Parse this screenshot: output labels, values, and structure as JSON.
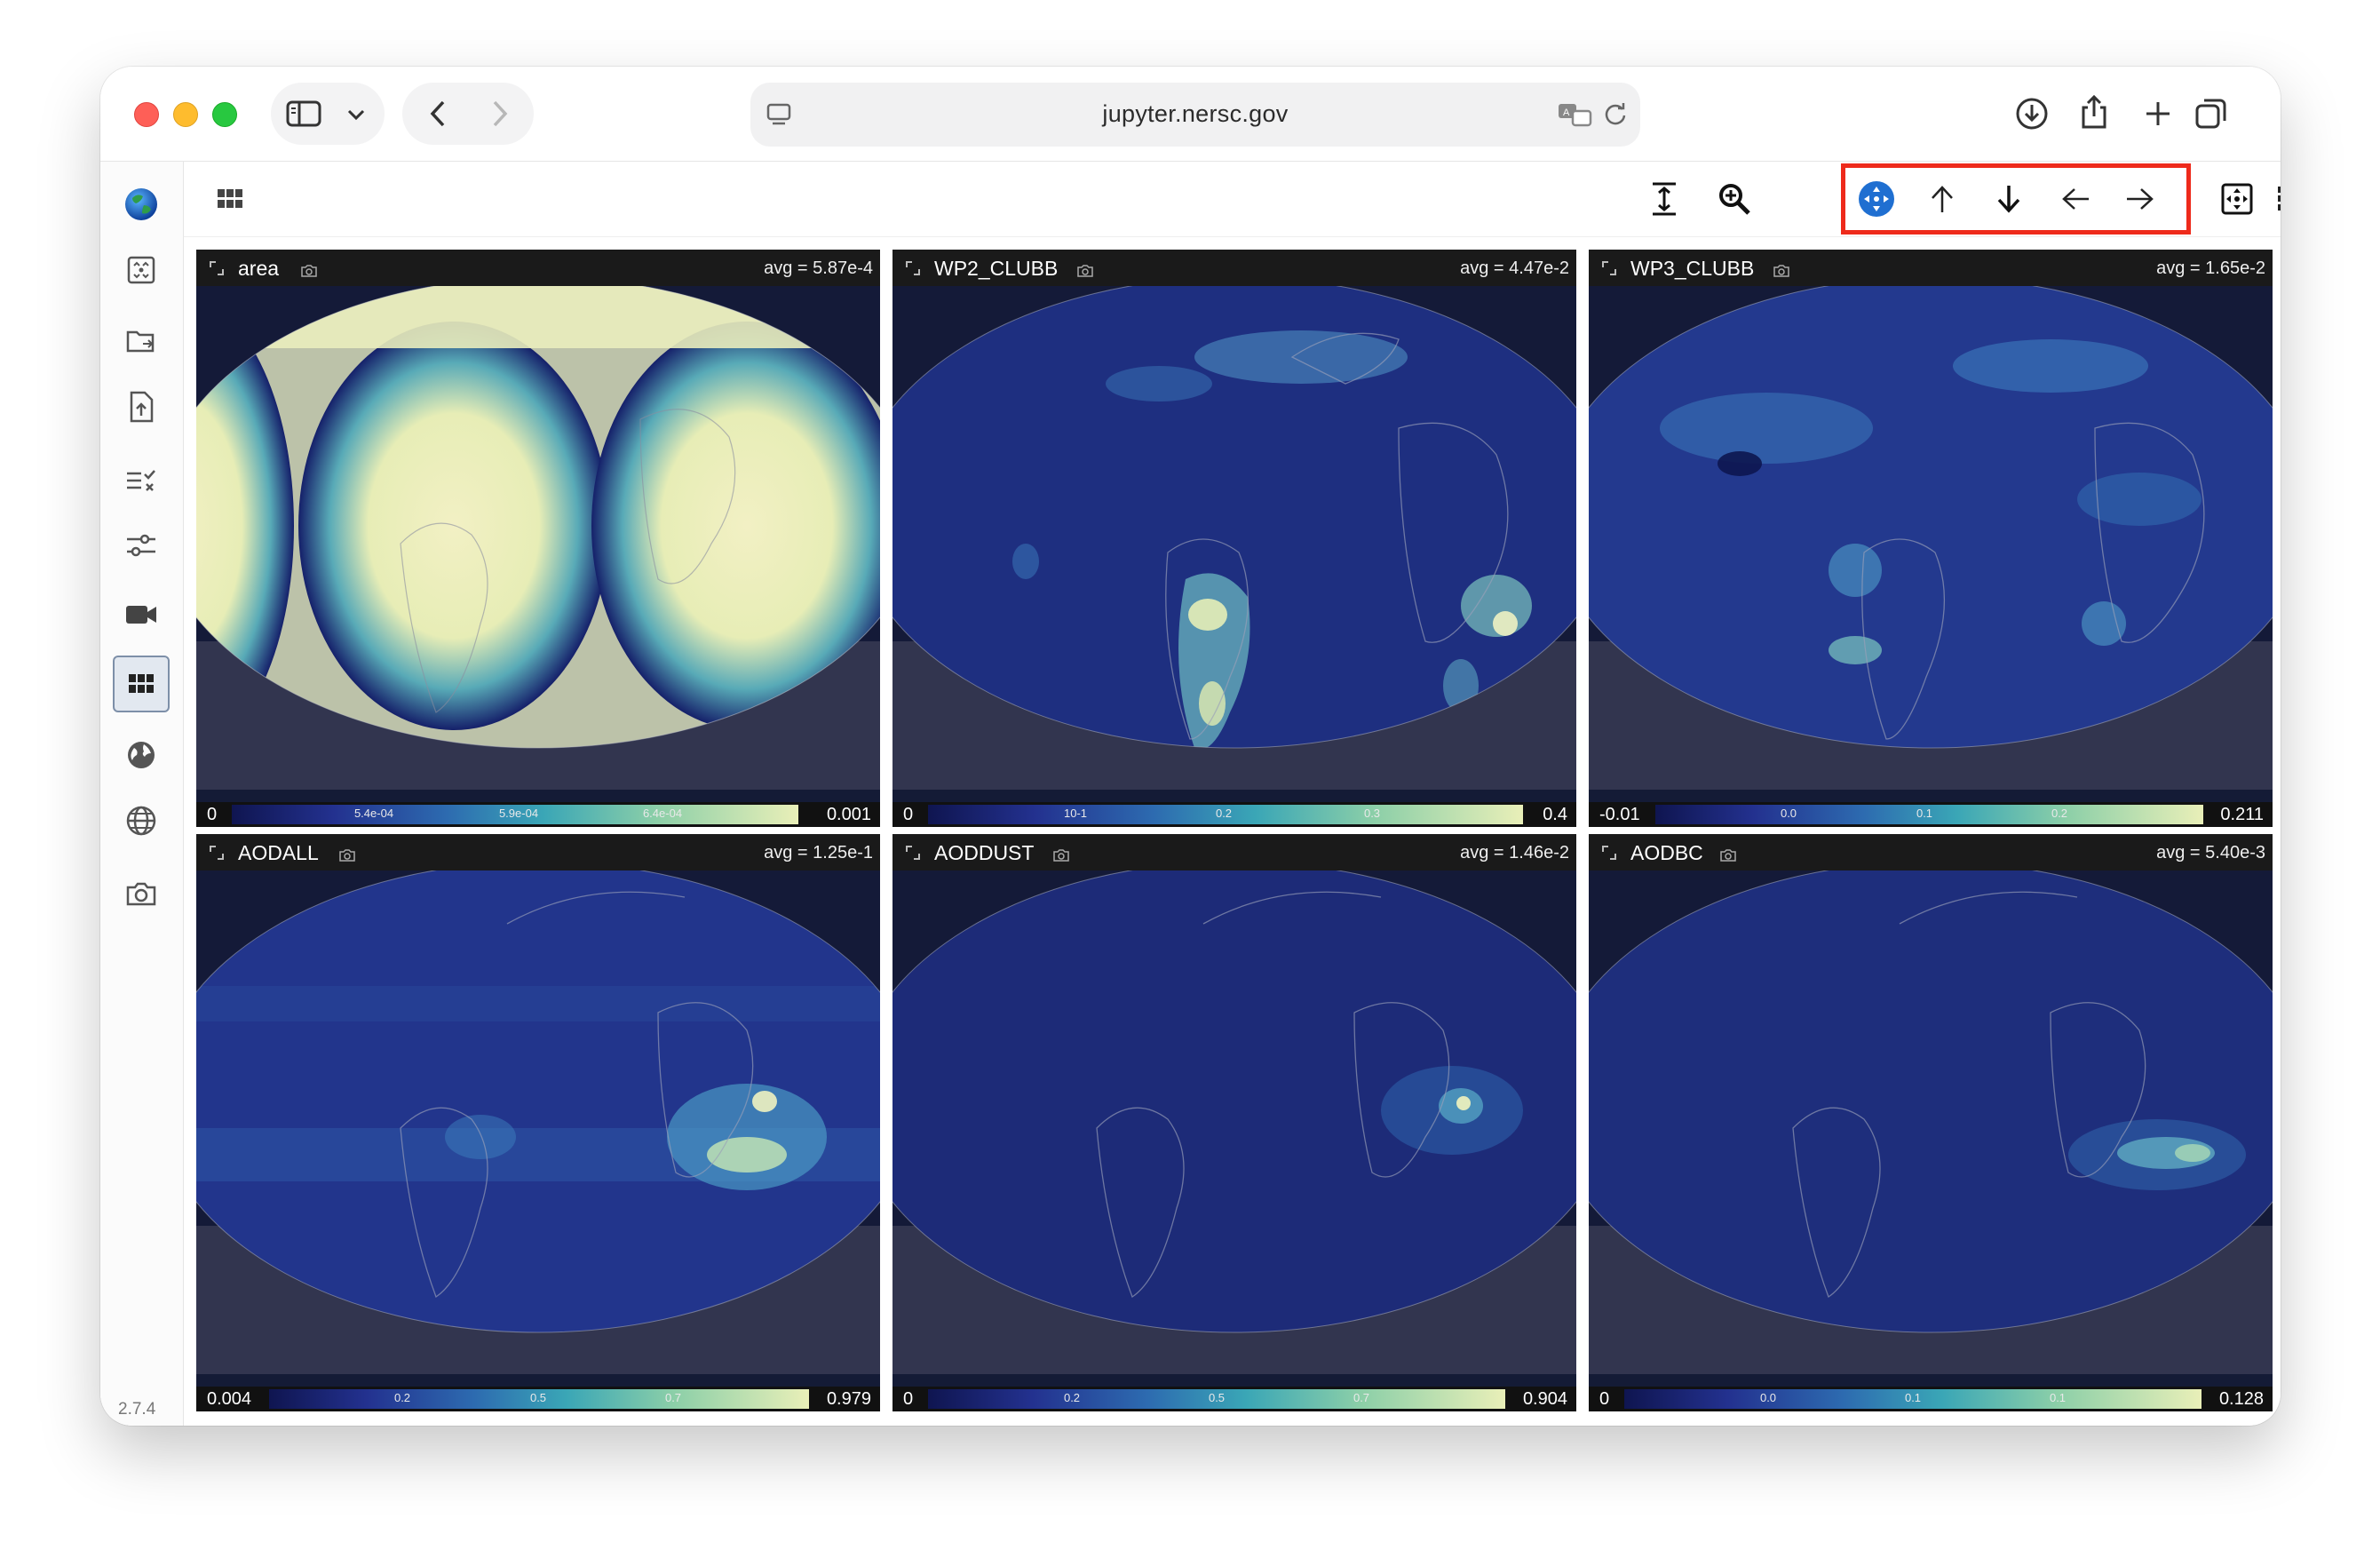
{
  "browser": {
    "url": "jupyter.nersc.gov"
  },
  "app": {
    "version": "2.7.4"
  },
  "panels": [
    {
      "name": "area",
      "avg": "avg = 5.87e-4",
      "cmin": "0",
      "cmax": "0.001",
      "ticks": [
        "5.4e-04",
        "5.9e-04",
        "6.4e-04"
      ]
    },
    {
      "name": "WP2_CLUBB",
      "avg": "avg = 4.47e-2",
      "cmin": "0",
      "cmax": "0.4",
      "ticks": [
        "10-1",
        "0.2",
        "0.3"
      ]
    },
    {
      "name": "WP3_CLUBB",
      "avg": "avg = 1.65e-2",
      "cmin": "-0.01",
      "cmax": "0.211",
      "ticks": [
        "0.0",
        "0.1",
        "0.2"
      ]
    },
    {
      "name": "AODALL",
      "avg": "avg = 1.25e-1",
      "cmin": "0.004",
      "cmax": "0.979",
      "ticks": [
        "0.2",
        "0.5",
        "0.7"
      ]
    },
    {
      "name": "AODDUST",
      "avg": "avg = 1.46e-2",
      "cmin": "0",
      "cmax": "0.904",
      "ticks": [
        "0.2",
        "0.5",
        "0.7"
      ]
    },
    {
      "name": "AODBC",
      "avg": "avg = 5.40e-3",
      "cmin": "0",
      "cmax": "0.128",
      "ticks": [
        "0.0",
        "0.1",
        "0.1"
      ]
    }
  ],
  "colors": {
    "highlight": "#ee2a1b",
    "accent": "#1f6fd1"
  },
  "icons": {
    "sidebar": [
      "globe-logo-icon",
      "frame-icon",
      "folder-swap-icon",
      "file-upload-icon",
      "checklist-icon",
      "sliders-icon",
      "video-camera-icon",
      "grid-icon",
      "globe-filled-icon",
      "globe-outline-icon",
      "camera-icon"
    ],
    "toolbar": [
      "fit-height-icon",
      "zoom-icon",
      "pan-move-icon",
      "arrow-up-icon",
      "arrow-down-icon",
      "arrow-left-icon",
      "arrow-right-icon",
      "reset-view-icon",
      "grid-layout-icon",
      "columns-layout-icon"
    ]
  }
}
